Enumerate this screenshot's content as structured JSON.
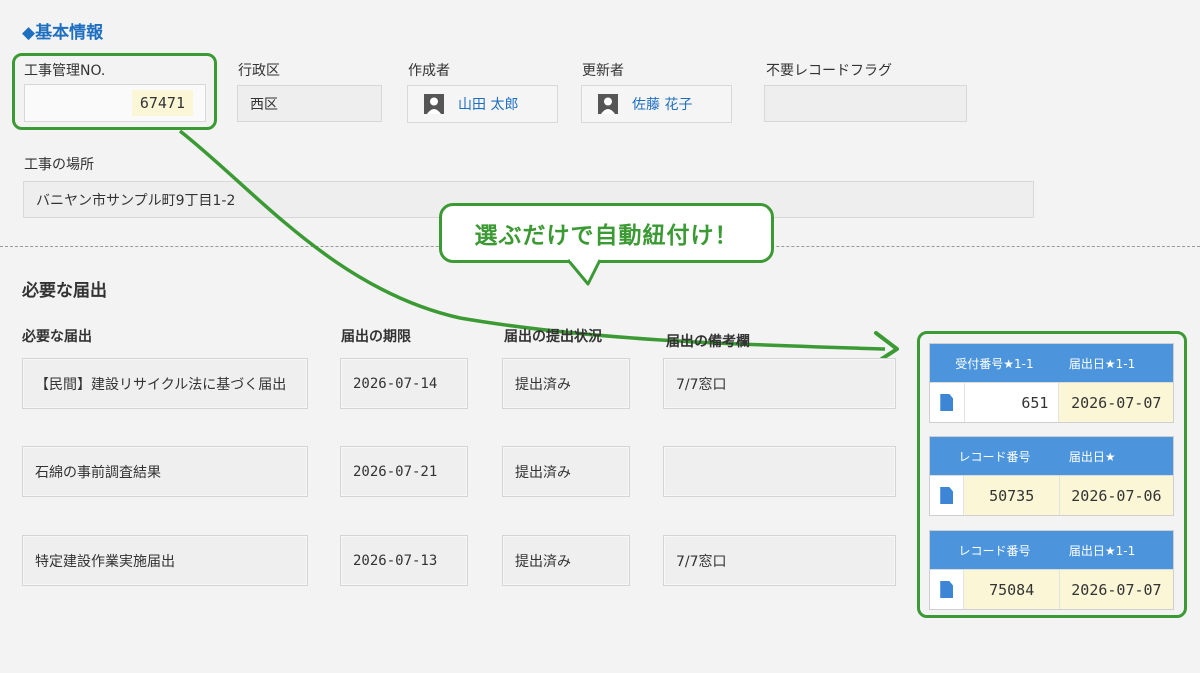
{
  "basic_info": {
    "title": "◆基本情報",
    "construction_no_label": "工事管理NO.",
    "construction_no_value": "67471",
    "ward_label": "行政区",
    "ward_value": "西区",
    "creator_label": "作成者",
    "creator_value": "山田 太郎",
    "updater_label": "更新者",
    "updater_value": "佐藤 花子",
    "unneeded_flag_label": "不要レコードフラグ",
    "unneeded_flag_value": "",
    "location_label": "工事の場所",
    "location_value": "バニヤン市サンプル町9丁目1-2"
  },
  "callout": {
    "text": "選ぶだけで自動紐付け！"
  },
  "notifications": {
    "section_title": "必要な届出",
    "columns": [
      "必要な届出",
      "届出の期限",
      "届出の提出状況",
      "届出の備考欄"
    ],
    "rows": [
      {
        "name": "【民間】建設リサイクル法に基づく届出",
        "deadline": "2026-07-14",
        "status": "提出済み",
        "note": "7/7窓口"
      },
      {
        "name": "石綿の事前調査結果",
        "deadline": "2026-07-21",
        "status": "提出済み",
        "note": ""
      },
      {
        "name": "特定建設作業実施届出",
        "deadline": "2026-07-13",
        "status": "提出済み",
        "note": "7/7窓口"
      }
    ]
  },
  "linked_records": [
    {
      "col1_header": "受付番号★1-1",
      "col2_header": "届出日★1-1",
      "number": "651",
      "date": "2026-07-07"
    },
    {
      "col1_header": "レコード番号",
      "col2_header": "届出日★",
      "number": "50735",
      "date": "2026-07-06"
    },
    {
      "col1_header": "レコード番号",
      "col2_header": "届出日★1-1",
      "number": "75084",
      "date": "2026-07-07"
    }
  ],
  "icons": {
    "user": "user-avatar-icon",
    "document": "document-icon"
  },
  "colors": {
    "accent_green": "#3c9a34",
    "heading_blue": "#1f6fc1",
    "table_header_blue": "#4c95dd"
  }
}
